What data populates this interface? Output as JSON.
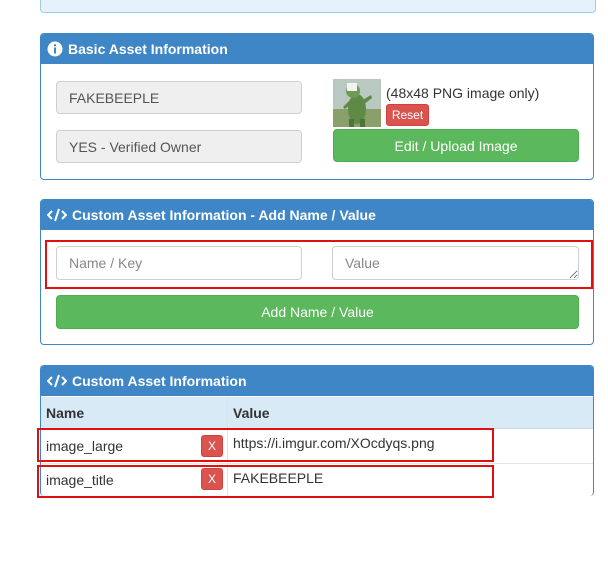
{
  "basic_panel": {
    "title": "Basic Asset Information",
    "asset_name": "FAKEBEEPLE",
    "owner_status": "YES - Verified Owner",
    "image_hint": "(48x48 PNG image only)",
    "reset_label": "Reset",
    "upload_label": "Edit / Upload Image"
  },
  "custom_add_panel": {
    "title": "Custom Asset Information - Add Name / Value",
    "name_placeholder": "Name / Key",
    "value_placeholder": "Value",
    "add_label": "Add Name / Value"
  },
  "custom_list_panel": {
    "title": "Custom Asset Information",
    "col_name": "Name",
    "col_value": "Value",
    "remove_label": "X",
    "rows": [
      {
        "name": "image_large",
        "value": "https://i.imgur.com/XOcdyqs.png"
      },
      {
        "name": "image_title",
        "value": "FAKEBEEPLE"
      }
    ]
  },
  "colors": {
    "panel_header": "#3f86c6",
    "success_button": "#5cb85c",
    "danger_button": "#d9534f",
    "highlight_outline": "#e01010"
  },
  "icons": {
    "basic_panel": "info-circle-icon",
    "custom_panels": "code-icon"
  }
}
